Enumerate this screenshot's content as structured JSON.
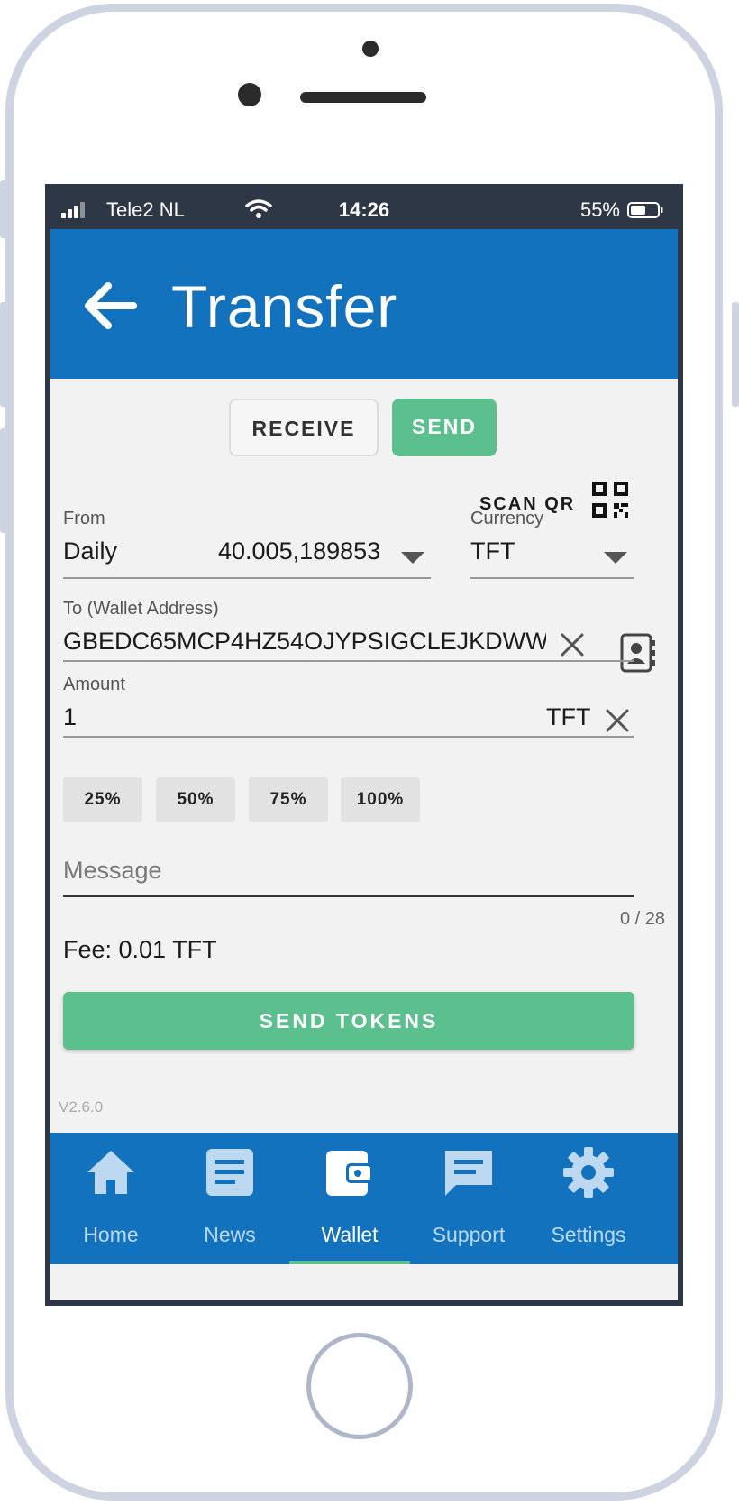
{
  "status_bar": {
    "carrier": "Tele2 NL",
    "time": "14:26",
    "battery": "55%"
  },
  "app_bar": {
    "title": "Transfer"
  },
  "segments": {
    "receive": "RECEIVE",
    "send": "SEND",
    "selected": "send"
  },
  "scan_qr": {
    "label": "SCAN QR"
  },
  "from": {
    "label": "From",
    "wallet": "Daily",
    "balance": "40.005,189853"
  },
  "currency": {
    "label": "Currency",
    "value": "TFT"
  },
  "to": {
    "label": "To (Wallet Address)",
    "value": "GBEDC65MCP4HZ54OJYPSIGCLEJKDWW"
  },
  "amount": {
    "label": "Amount",
    "value": "1",
    "unit": "TFT"
  },
  "percent_buttons": [
    "25%",
    "50%",
    "75%",
    "100%"
  ],
  "message": {
    "placeholder": "Message",
    "counter": "0 / 28"
  },
  "fee": "Fee: 0.01 TFT",
  "send_button": "SEND TOKENS",
  "version": "V2.6.0",
  "nav": {
    "items": [
      {
        "label": "Home",
        "icon": "home-icon"
      },
      {
        "label": "News",
        "icon": "news-icon"
      },
      {
        "label": "Wallet",
        "icon": "wallet-icon"
      },
      {
        "label": "Support",
        "icon": "support-icon"
      },
      {
        "label": "Settings",
        "icon": "settings-icon"
      }
    ],
    "active": "Wallet"
  },
  "colors": {
    "primary": "#1272bd",
    "accent": "#5bbf8e",
    "background": "#f2f2f2"
  }
}
